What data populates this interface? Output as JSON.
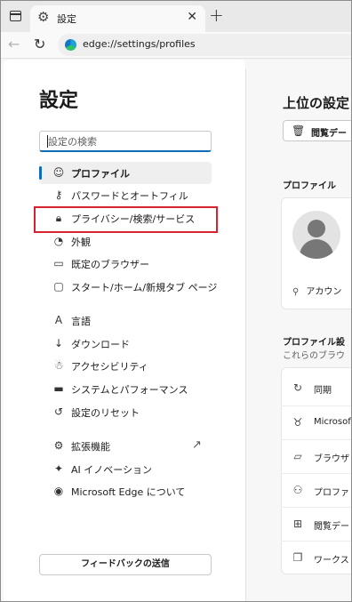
{
  "tab": {
    "title": "設定"
  },
  "address": {
    "url": "edge://settings/profiles"
  },
  "sidebar": {
    "title": "設定",
    "search_placeholder": "設定の検索",
    "items": [
      {
        "label": "プロファイル",
        "icon": "profile-icon",
        "active": true
      },
      {
        "label": "パスワードとオートフィル",
        "icon": "key-icon"
      },
      {
        "label": "プライバシー/検索/サービス",
        "icon": "lock-icon",
        "highlighted": true
      },
      {
        "label": "外観",
        "icon": "appearance-icon"
      },
      {
        "label": "既定のブラウザー",
        "icon": "browser-icon"
      },
      {
        "label": "スタート/ホーム/新規タブ ページ",
        "icon": "home-icon"
      },
      {
        "label": "言語",
        "icon": "language-icon"
      },
      {
        "label": "ダウンロード",
        "icon": "download-icon"
      },
      {
        "label": "アクセシビリティ",
        "icon": "accessibility-icon"
      },
      {
        "label": "システムとパフォーマンス",
        "icon": "laptop-icon"
      },
      {
        "label": "設定のリセット",
        "icon": "reset-icon"
      },
      {
        "label": "拡張機能",
        "icon": "extensions-icon"
      },
      {
        "label": "AI イノベーション",
        "icon": "ai-icon"
      },
      {
        "label": "Microsoft Edge について",
        "icon": "edge-icon"
      }
    ],
    "feedback_label": "フィードバックの送信"
  },
  "main": {
    "title": "上位の設定",
    "history_button": "閲覧デー",
    "profile_section_title": "プロファイル",
    "account_label": "アカウン",
    "profile_settings_title": "プロファイル設",
    "profile_settings_subtitle": "これらのブラウ",
    "rows": [
      {
        "label": "同期",
        "icon": "sync-icon"
      },
      {
        "label": "Microsof",
        "icon": "rewards-icon"
      },
      {
        "label": "ブラウザ",
        "icon": "folder-icon"
      },
      {
        "label": "プロファ",
        "icon": "profile-prefs-icon"
      },
      {
        "label": "閲覧デー",
        "icon": "windows-icon"
      },
      {
        "label": "ワークス",
        "icon": "workspaces-icon"
      }
    ]
  },
  "colors": {
    "accent": "#0f6cbd",
    "highlight_box": "#d7232f"
  }
}
